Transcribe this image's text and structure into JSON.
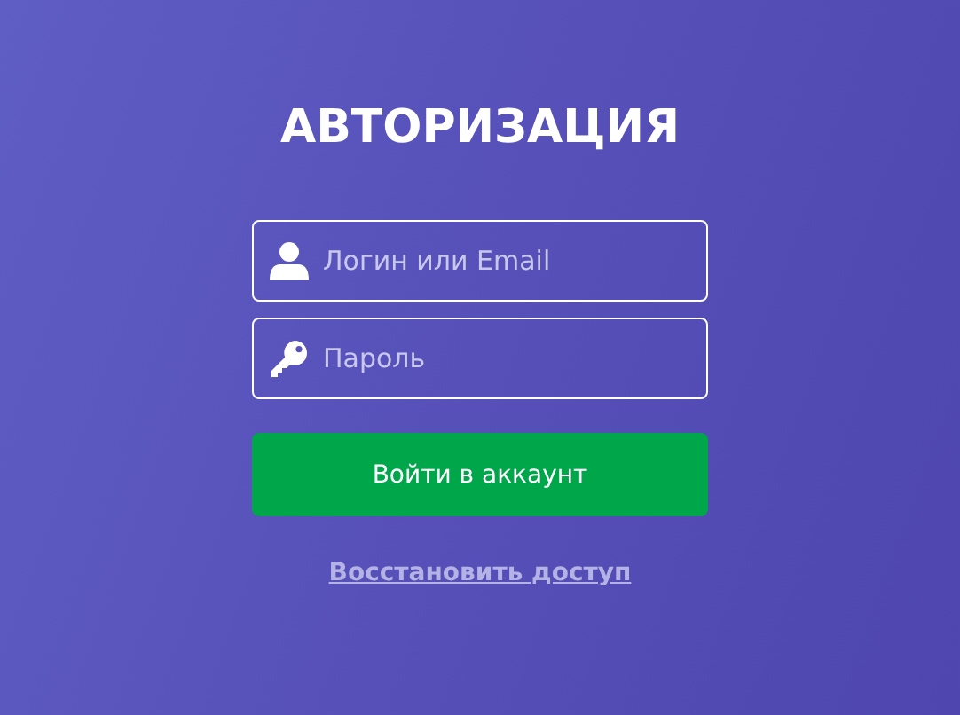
{
  "title": "АВТОРИЗАЦИЯ",
  "fields": [
    {
      "kind": "user",
      "placeholder": "Логин или Email"
    },
    {
      "kind": "key",
      "placeholder": "Пароль"
    }
  ],
  "submit_button": "Войти в аккаунт",
  "recover_link": "Восстановить доступ"
}
